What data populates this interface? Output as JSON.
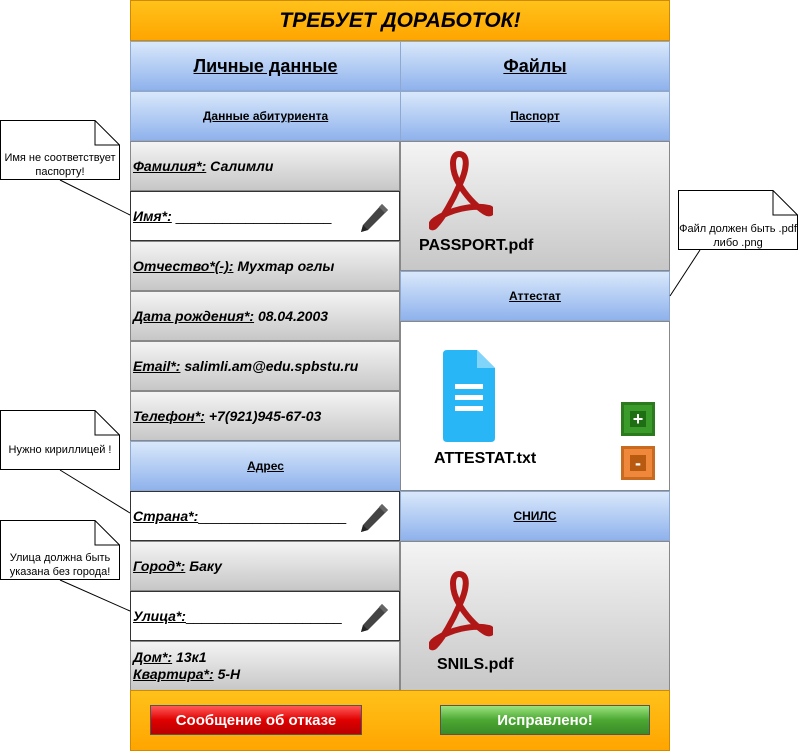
{
  "header": {
    "title": "ТРЕБУЕТ ДОРАБОТОК!"
  },
  "left": {
    "title": "Личные данные",
    "section_applicant": "Данные абитуриента",
    "fields": {
      "surname_label": "Фамилия*:",
      "surname_value": "Салимли",
      "name_label": "Имя*:",
      "name_value": "____________________",
      "patronymic_label": "Отчество*(-):",
      "patronymic_value": "Мухтар оглы",
      "birthdate_label": "Дата рождения*:",
      "birthdate_value": "08.04.2003",
      "email_label": "Email*:",
      "email_value": "salimli.am@edu.spbstu.ru",
      "phone_label": "Телефон*:",
      "phone_value": "+7(921)945-67-03"
    },
    "section_address": "Адрес",
    "address": {
      "country_label": "Страна*:",
      "country_value": "___________________",
      "city_label": "Город*:",
      "city_value": "Баку",
      "street_label": "Улица*:",
      "street_value": "____________________",
      "house_label": "Дом*:",
      "house_value": "13к1",
      "apartment_label": "Квартира*:",
      "apartment_value": "5-Н"
    }
  },
  "right": {
    "title": "Файлы",
    "passport": {
      "section": "Паспорт",
      "file": "PASSPORT.pdf",
      "icon": "pdf-icon"
    },
    "certificate": {
      "section": "Аттестат",
      "file": "ATTESTAT.txt",
      "icon": "document-icon",
      "add_label": "+",
      "remove_label": "-"
    },
    "snils": {
      "section": "СНИЛС",
      "file": "SNILS.pdf",
      "icon": "pdf-icon"
    }
  },
  "buttons": {
    "reject": "Сообщение об отказе",
    "fixed": "Исправлено!"
  },
  "notes": {
    "name": "Имя не соответствует паспорту!",
    "country": "Нужно кириллицей !",
    "street": "Улица должна быть указана без города!",
    "file_format": "Файл должен быть .pdf либо .png"
  },
  "colors": {
    "header": "#ffa500",
    "section_blue": "#8fb2ec",
    "reject": "#e00000",
    "fixed": "#4ca832",
    "pdf_red": "#b01818",
    "doc_blue": "#29b6f6"
  }
}
